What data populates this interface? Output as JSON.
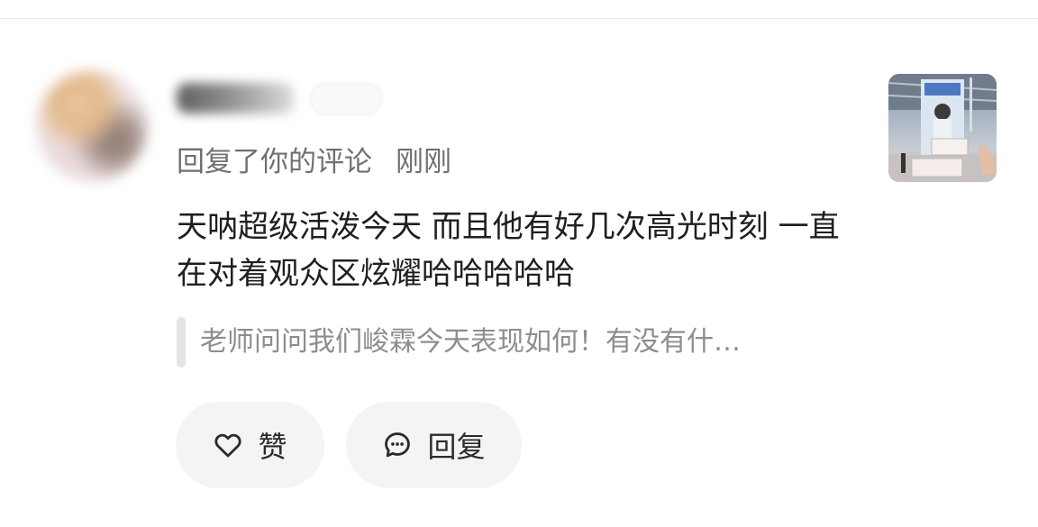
{
  "header": {
    "divider": true
  },
  "notification": {
    "avatar_icon": "avatar",
    "username": "",
    "level_badge": "",
    "action_text": "回复了你的评论",
    "time_text": "刚刚",
    "comment_text": "天呐超级活泼今天 而且他有好几次高光时刻 一直在对着观众区炫耀哈哈哈哈哈",
    "quoted_text": "老师问问我们峻霖今天表现如何！有没有什…",
    "thumbnail_icon": "post-thumbnail-image"
  },
  "actions": {
    "like_label": "赞",
    "like_icon": "heart-outline-icon",
    "reply_label": "回复",
    "reply_icon": "chat-bubble-icon"
  },
  "colors": {
    "background": "#ffffff",
    "button_bg": "#f4f4f4",
    "primary_text": "#1f1f1f",
    "secondary_text": "#707070",
    "quote_text": "#8d8d8d",
    "quote_bar": "#e4e4e4"
  }
}
